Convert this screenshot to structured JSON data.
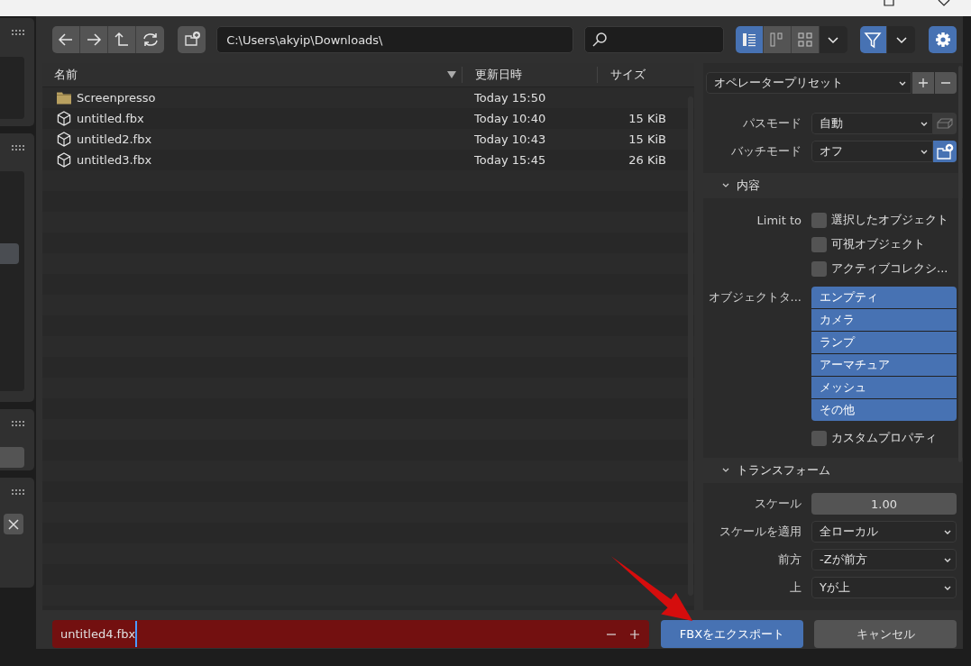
{
  "toolbar": {
    "path": "C:\\Users\\akyip\\Downloads\\",
    "display_modes": [
      {
        "kind": "list",
        "selected": true
      },
      {
        "kind": "columns",
        "selected": false
      },
      {
        "kind": "grid",
        "selected": false
      }
    ],
    "filter_on": true
  },
  "file_list": {
    "columns": [
      "名前",
      "更新日時",
      "サイズ"
    ],
    "rows": [
      {
        "kind": "folder",
        "name": "Screenpresso",
        "date": "Today 15:50"
      },
      {
        "kind": "file",
        "name": "untitled.fbx",
        "date": "Today 10:40",
        "size": "15 KiB"
      },
      {
        "kind": "file",
        "name": "untitled2.fbx",
        "date": "Today 10:43",
        "size": "15 KiB"
      },
      {
        "kind": "file",
        "name": "untitled3.fbx",
        "date": "Today 15:45",
        "size": "26 KiB"
      }
    ]
  },
  "sidebar": {
    "preset": "オペレータープリセット",
    "modes": [
      {
        "label": "パスモード",
        "value": "自動",
        "toggle_on": false
      },
      {
        "label": "バッチモード",
        "value": "オフ",
        "toggle_on": true
      }
    ],
    "include": {
      "title": "内容",
      "expanded": true,
      "limit_label": "Limit to",
      "limit_options": [
        {
          "label": "選択したオブジェクト",
          "checked": false
        },
        {
          "label": "可視オブジェクト",
          "checked": false
        },
        {
          "label": "アクティブコレクシ...",
          "checked": false
        }
      ],
      "object_types_label": "オブジェクトタ...",
      "object_types": [
        {
          "label": "エンプティ",
          "selected": true
        },
        {
          "label": "カメラ",
          "selected": true
        },
        {
          "label": "ランプ",
          "selected": true
        },
        {
          "label": "アーマチュア",
          "selected": true
        },
        {
          "label": "メッシュ",
          "selected": true
        },
        {
          "label": "その他",
          "selected": true
        }
      ],
      "custom_properties": {
        "label": "カスタムプロパティ",
        "checked": false
      }
    },
    "transform": {
      "title": "トランスフォーム",
      "expanded": true,
      "fields": [
        {
          "kind": "number",
          "label": "スケール",
          "value": "1.00"
        },
        {
          "kind": "dropdown",
          "label": "スケールを適用",
          "value": "全ローカル"
        },
        {
          "kind": "dropdown",
          "label": "前方",
          "value": "-Zが前方"
        },
        {
          "kind": "dropdown",
          "label": "上",
          "value": "Yが上"
        }
      ]
    }
  },
  "bottom": {
    "filename": "untitled4.fbx",
    "file_exists": true,
    "export_button": "FBXをエクスポート",
    "cancel_button": "キャンセル"
  }
}
